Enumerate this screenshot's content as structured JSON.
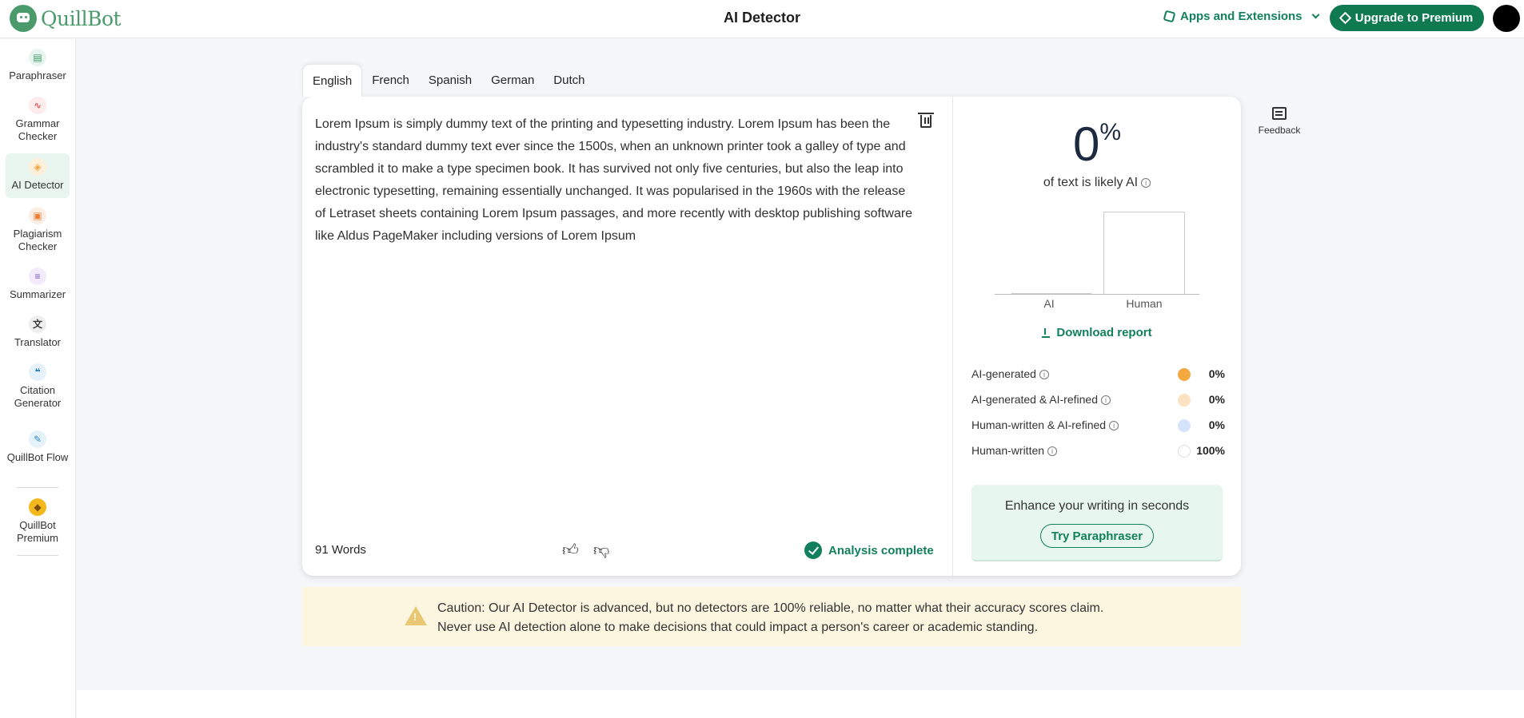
{
  "app": {
    "logo_text": "QuillBot",
    "title": "AI Detector"
  },
  "header": {
    "apps_label": "Apps and Extensions",
    "upgrade_label": "Upgrade to Premium"
  },
  "sidebar": {
    "items": [
      {
        "label": "Paraphraser",
        "icon": "paraphraser-icon",
        "color": "#3e9a68"
      },
      {
        "label": "Grammar Checker",
        "icon": "grammar-icon",
        "color": "#e8585b"
      },
      {
        "label": "AI Detector",
        "icon": "ai-detector-icon",
        "color": "#f2a23d"
      },
      {
        "label": "Plagiarism Checker",
        "icon": "plagiarism-icon",
        "color": "#f08036"
      },
      {
        "label": "Summarizer",
        "icon": "summarizer-icon",
        "color": "#7a51c9"
      },
      {
        "label": "Translator",
        "icon": "translator-icon",
        "color": "#3a3a3a"
      },
      {
        "label": "Citation Generator",
        "icon": "citation-icon",
        "color": "#1b7ac8"
      },
      {
        "label": "QuillBot Flow",
        "icon": "flow-icon",
        "color": "#2d8bc6"
      },
      {
        "label": "QuillBot Premium",
        "icon": "premium-icon",
        "color": "#e2aa16"
      }
    ]
  },
  "tabs": [
    "English",
    "French",
    "Spanish",
    "German",
    "Dutch"
  ],
  "editor": {
    "text": "Lorem Ipsum is simply dummy text of the printing and typesetting industry. Lorem Ipsum has been the industry's standard dummy text ever since the 1500s, when an unknown printer took a galley of type and scrambled it to make a type specimen book. It has survived not only five centuries, but also the leap into electronic typesetting, remaining essentially unchanged. It was popularised in the 1960s with the release of Letraset sheets containing Lorem Ipsum passages, and more recently with desktop publishing software like Aldus PageMaker including versions of Lorem Ipsum",
    "word_count": "91 Words",
    "status": "Analysis complete"
  },
  "results": {
    "percent": "0",
    "percent_sign": "%",
    "caption": "of text is likely AI",
    "chart_labels": [
      "AI",
      "Human"
    ],
    "chart_values": {
      "AI": 0,
      "Human": 100
    },
    "download_label": "Download report",
    "breakdown": [
      {
        "label": "AI-generated",
        "value": "0%",
        "color": "#f3a93f"
      },
      {
        "label": "AI-generated & AI-refined",
        "value": "0%",
        "color": "#fbe3c2"
      },
      {
        "label": "Human-written & AI-refined",
        "value": "0%",
        "color": "#d6e4fb"
      },
      {
        "label": "Human-written",
        "value": "100%",
        "color": "#ffffff"
      }
    ],
    "promo_title": "Enhance your writing in seconds",
    "promo_button": "Try Paraphraser"
  },
  "feedback_label": "Feedback",
  "caution": {
    "line1": "Caution: Our AI Detector is advanced, but no detectors are 100% reliable, no matter what their accuracy scores claim.",
    "line2": "Never use AI detection alone to make decisions that could impact a person's career or academic standing."
  }
}
